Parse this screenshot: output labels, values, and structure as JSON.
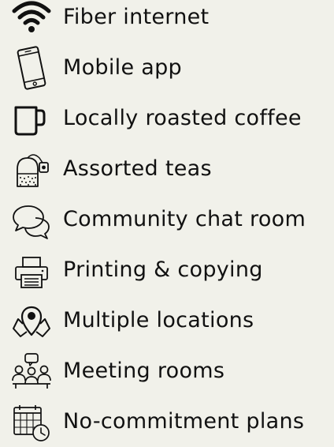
{
  "amenities": [
    {
      "label": "Fiber internet",
      "icon": "wifi-icon"
    },
    {
      "label": "Mobile app",
      "icon": "mobile-phone-icon"
    },
    {
      "label": "Locally roasted coffee",
      "icon": "coffee-mug-icon"
    },
    {
      "label": "Assorted teas",
      "icon": "tea-bag-icon"
    },
    {
      "label": "Community chat room",
      "icon": "chat-bubbles-icon"
    },
    {
      "label": "Printing & copying",
      "icon": "printer-icon"
    },
    {
      "label": "Multiple locations",
      "icon": "location-pin-icon"
    },
    {
      "label": "Meeting rooms",
      "icon": "meeting-people-icon"
    },
    {
      "label": "No-commitment plans",
      "icon": "calendar-clock-icon"
    }
  ]
}
